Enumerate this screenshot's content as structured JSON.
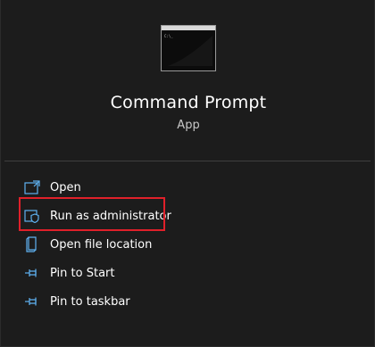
{
  "app": {
    "title": "Command Prompt",
    "type": "App",
    "icon": "command-prompt-icon"
  },
  "menu": {
    "items": [
      {
        "label": "Open",
        "icon": "open-window-icon"
      },
      {
        "label": "Run as administrator",
        "icon": "shield-icon"
      },
      {
        "label": "Open file location",
        "icon": "file-location-icon"
      },
      {
        "label": "Pin to Start",
        "icon": "pin-icon"
      },
      {
        "label": "Pin to taskbar",
        "icon": "pin-icon"
      }
    ]
  },
  "colors": {
    "background": "#1c1c1c",
    "icon_accent": "#5fb2f2",
    "highlight": "#e0202a"
  }
}
